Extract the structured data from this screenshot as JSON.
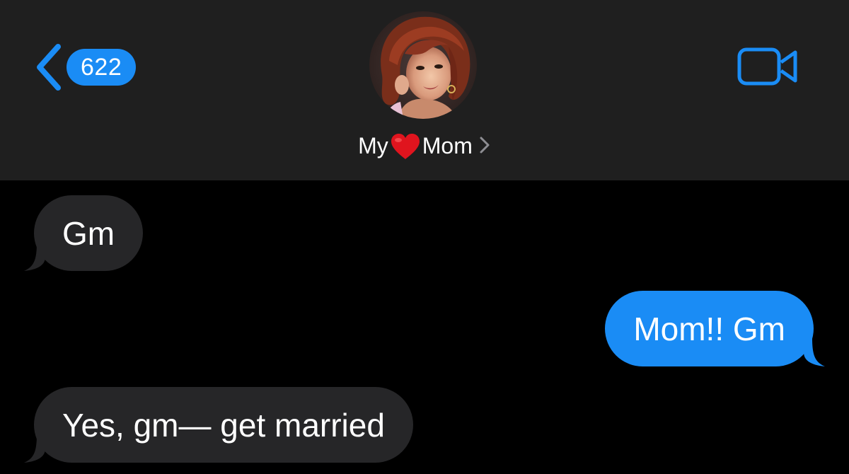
{
  "header": {
    "back_badge": "622",
    "contact": {
      "name_prefix": "My",
      "name_suffix": "Mom",
      "emoji": "heart"
    },
    "icons": {
      "back": "chevron-left-icon",
      "video": "video-camera-icon",
      "disclosure": "chevron-right-icon"
    }
  },
  "messages": [
    {
      "direction": "incoming",
      "text": "Gm"
    },
    {
      "direction": "outgoing",
      "text": "Mom!! Gm"
    },
    {
      "direction": "incoming",
      "text": "Yes, gm— get married"
    }
  ],
  "colors": {
    "accent": "#1a8cf5",
    "header_bg": "#1f1f1f",
    "incoming_bubble": "#262628",
    "outgoing_bubble": "#1a8cf5",
    "background": "#000000",
    "heart": "#e0141e"
  }
}
